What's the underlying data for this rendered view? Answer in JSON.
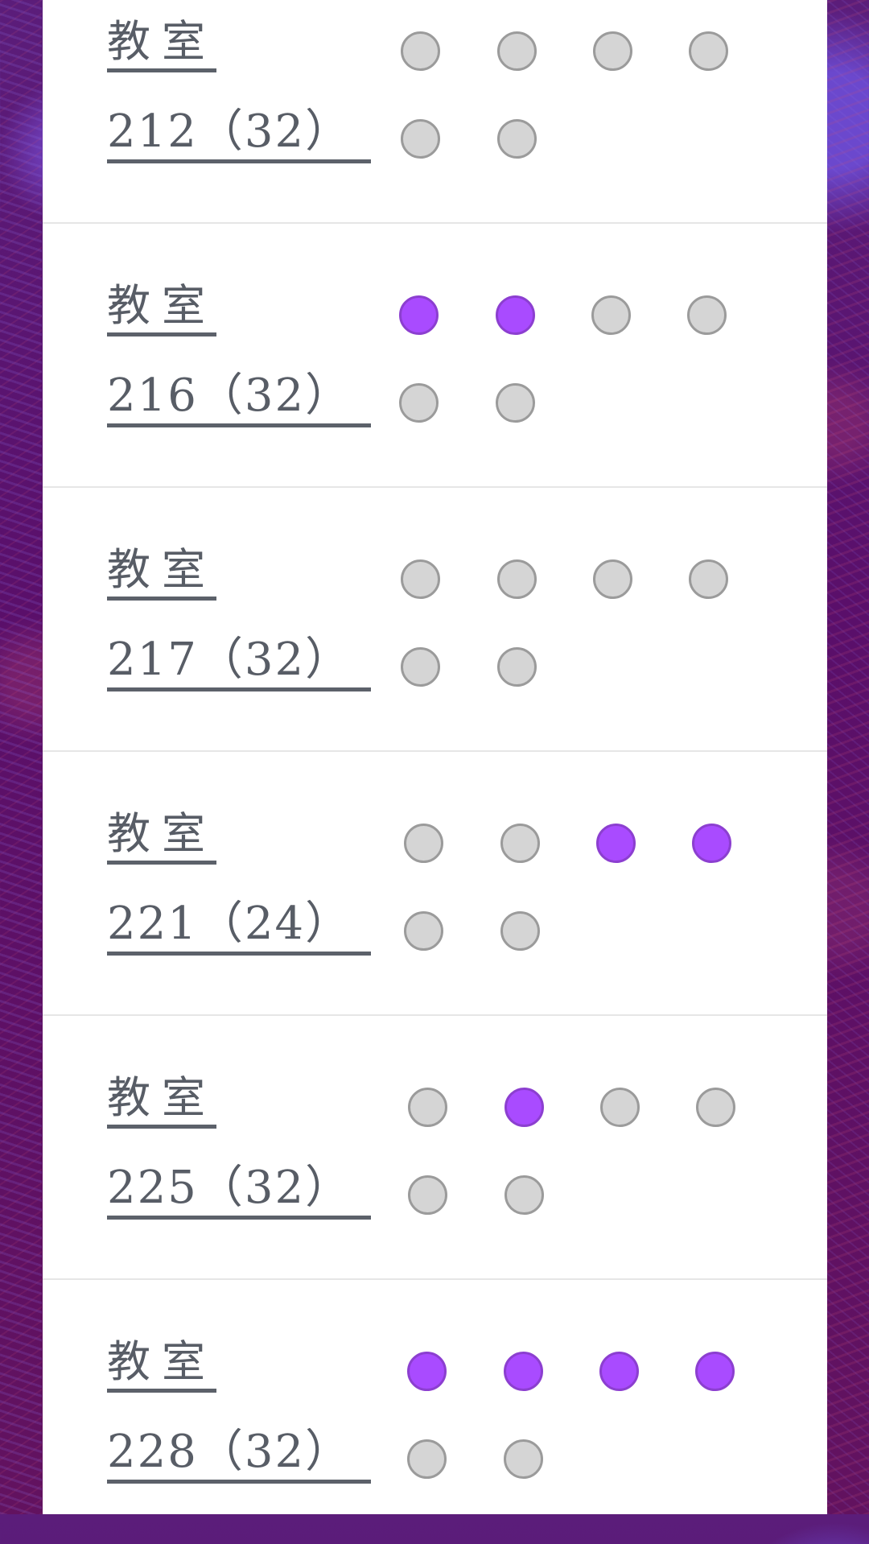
{
  "colors": {
    "dot_empty": "#d5d5d5",
    "dot_filled": "#a94bff",
    "label_text": "#585d66"
  },
  "rooms": [
    {
      "label": "教室",
      "number": "212（32）",
      "slots": [
        false,
        false,
        false,
        false,
        false,
        false
      ]
    },
    {
      "label": "教室",
      "number": "216（32）",
      "slots": [
        true,
        true,
        false,
        false,
        false,
        false
      ]
    },
    {
      "label": "教室",
      "number": "217（32）",
      "slots": [
        false,
        false,
        false,
        false,
        false,
        false
      ]
    },
    {
      "label": "教室",
      "number": "221（24）",
      "slots": [
        false,
        false,
        true,
        true,
        false,
        false
      ]
    },
    {
      "label": "教室",
      "number": "225（32）",
      "slots": [
        false,
        true,
        false,
        false,
        false,
        false
      ]
    },
    {
      "label": "教室",
      "number": "228（32）",
      "slots": [
        true,
        true,
        true,
        true,
        false,
        false
      ]
    }
  ]
}
